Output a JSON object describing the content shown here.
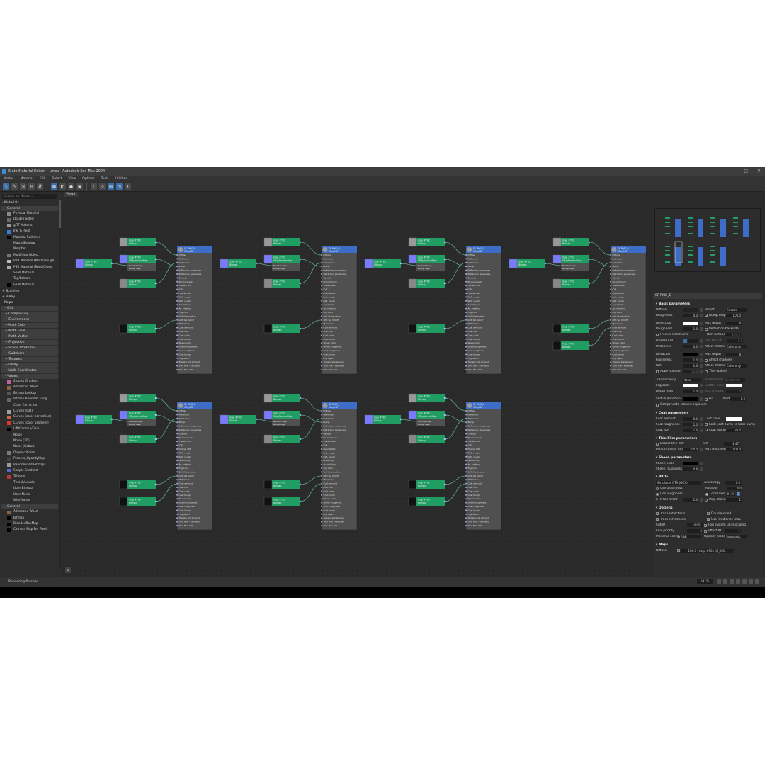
{
  "window": {
    "app_name": "Slate Material Editor",
    "title_suffix": ".max - Autodesk 3ds Max 2024",
    "controls": [
      "—",
      "□",
      "✕"
    ]
  },
  "menu": [
    "Modes",
    "Material",
    "Edit",
    "Select",
    "View",
    "Options",
    "Tools",
    "Utilities"
  ],
  "view_tab": "View1",
  "browser": {
    "search_placeholder": "Search by Name ...",
    "sections": [
      {
        "label": "- Materials",
        "kind": "sec"
      },
      {
        "label": "- General",
        "kind": "sub"
      },
      {
        "label": "Physical Material",
        "kind": "item",
        "color": "#8a8a8a"
      },
      {
        "label": "Double Sided",
        "kind": "item",
        "color": "#6a6a6a"
      },
      {
        "label": "glTF Material",
        "kind": "item",
        "color": "#9a9a9a"
      },
      {
        "label": "Ink 'n Paint",
        "kind": "item",
        "color": "#3a7bd5"
      },
      {
        "label": "Material Switcher",
        "kind": "item",
        "color": "#000000"
      },
      {
        "label": "Matte/Shadow",
        "kind": "item",
        "color": "#2d2d2d"
      },
      {
        "label": "Morpher",
        "kind": "item",
        "color": "#2d2d2d"
      },
      {
        "label": "Multi/Sub-Object",
        "kind": "item",
        "color": "#777777"
      },
      {
        "label": "PBR Material (Metal/Rough)",
        "kind": "item",
        "color": "#bbbbbb"
      },
      {
        "label": "PBR Material (Spec/Gloss)",
        "kind": "item",
        "color": "#aaaaaa"
      },
      {
        "label": "Shell Material",
        "kind": "item",
        "color": "#2d2d2d"
      },
      {
        "label": "Top/Bottom",
        "kind": "item",
        "color": "#2d2d2d"
      },
      {
        "label": "Shell Material",
        "kind": "item",
        "color": "#000000"
      },
      {
        "label": "+ Scanline",
        "kind": "sec"
      },
      {
        "label": "+ V-Ray",
        "kind": "sec"
      },
      {
        "label": "- Maps",
        "kind": "sec"
      },
      {
        "label": "- OSL",
        "kind": "sub"
      },
      {
        "label": "+ Compositing",
        "kind": "sub"
      },
      {
        "label": "+ Environment",
        "kind": "sub"
      },
      {
        "label": "+ Math Color",
        "kind": "sub"
      },
      {
        "label": "+ Math Float",
        "kind": "sub"
      },
      {
        "label": "+ Math Vector",
        "kind": "sub"
      },
      {
        "label": "+ Projection",
        "kind": "sub"
      },
      {
        "label": "+ Scene Attributes",
        "kind": "sub"
      },
      {
        "label": "+ Switchers",
        "kind": "sub"
      },
      {
        "label": "+ Textures",
        "kind": "sub"
      },
      {
        "label": "+ Utility",
        "kind": "sub"
      },
      {
        "label": "+ UVW Coordinates",
        "kind": "sub"
      },
      {
        "label": "- Values",
        "kind": "sub"
      },
      {
        "label": "4-point Gradient",
        "kind": "item",
        "color": "#c060a0"
      },
      {
        "label": "Advanced Wood",
        "kind": "item",
        "color": "#8a6040"
      },
      {
        "label": "Bitmap Lookup",
        "kind": "item",
        "color": "#555555"
      },
      {
        "label": "Bitmap Random Tiling",
        "kind": "item",
        "color": "#666666"
      },
      {
        "label": "Color Correction",
        "kind": "item",
        "color": "#2d2d2d"
      },
      {
        "label": "Curve (float)",
        "kind": "item",
        "color": "#a0a0a0"
      },
      {
        "label": "Curves (color correction)",
        "kind": "item",
        "color": "#cc6644"
      },
      {
        "label": "Curves (color gradient)",
        "kind": "item",
        "color": "#dd3333"
      },
      {
        "label": "Lift/Gamma/Gain",
        "kind": "item",
        "color": "#000000"
      },
      {
        "label": "Noise",
        "kind": "item",
        "color": "#2d2d2d"
      },
      {
        "label": "Noise (3D)",
        "kind": "item",
        "color": "#2d2d2d"
      },
      {
        "label": "Noise (Gabor)",
        "kind": "item",
        "color": "#2d2d2d"
      },
      {
        "label": "Organic Noise",
        "kind": "item",
        "color": "#7a7a7a"
      },
      {
        "label": "Process_OpacityMap",
        "kind": "item",
        "color": "#444444"
      },
      {
        "label": "Randomized Bitmaps",
        "kind": "item",
        "color": "#999999"
      },
      {
        "label": "Simple Gradient",
        "kind": "item",
        "color": "#5566cc"
      },
      {
        "label": "Tri-tone",
        "kind": "item",
        "color": "#bb3333"
      },
      {
        "label": "Thresh/Levels",
        "kind": "item",
        "color": "#2d2d2d"
      },
      {
        "label": "Uber Bitmap",
        "kind": "item",
        "color": "#2d2d2d"
      },
      {
        "label": "Uber Noise",
        "kind": "item",
        "color": "#2d2d2d"
      },
      {
        "label": "WireFrame",
        "kind": "item",
        "color": "#2d2d2d"
      },
      {
        "label": "- General",
        "kind": "sub"
      },
      {
        "label": "Advanced Wood",
        "kind": "item",
        "color": "#8a6040"
      },
      {
        "label": "Bitmap",
        "kind": "item",
        "color": "#000000"
      },
      {
        "label": "BlendedBoxMap",
        "kind": "item",
        "color": "#000000"
      },
      {
        "label": "Camera Map Per Pixel",
        "kind": "item",
        "color": "#000000"
      }
    ]
  },
  "graph": {
    "groups": [
      {
        "mat": "SF RMG_8",
        "row": 0,
        "col": 0
      },
      {
        "mat": "SF RMG_9",
        "row": 0,
        "col": 1
      },
      {
        "mat": "SF RMG_C",
        "row": 0,
        "col": 2
      },
      {
        "mat": "SF RMG_0",
        "row": 0,
        "col": 3
      },
      {
        "mat": "SF RMG_E",
        "row": 1,
        "col": 0
      },
      {
        "mat": "SF RMG_F",
        "row": 1,
        "col": 1
      },
      {
        "mat": "SF RMG_A",
        "row": 1,
        "col": 2
      }
    ],
    "map_node_title": "map #782",
    "map_node_type": "Bitmap",
    "normal_node_type": "VRayNormalMap",
    "normal_ports": [
      "Normal map",
      "Bump map"
    ],
    "mat_type": "VRayMtl",
    "mat_ports": [
      "Diffuse",
      "Reflection",
      "Refraction",
      "Bump",
      "Reflection roughness",
      "Refraction glossiness",
      "Opacity",
      "Environment",
      "Translucent",
      "IOR",
      "Fresnel IOR",
      "Refl. rough",
      "Refr. rough",
      "Anisotropy",
      "An. rotation",
      "Fog color",
      "Self illumination",
      "GTR tail falloff",
      "Metalness",
      "Coat amount",
      "Coat IOR",
      "Coat color",
      "Coat bump",
      "Sheen color",
      "Sheen roughness",
      "Coat roughness",
      "Coat bump",
      "Fog depth",
      "Translucent amount",
      "Thin Film Thickness",
      "Thin Film IOR"
    ]
  },
  "props": {
    "header": "SF RMG_E",
    "basic": {
      "title": "Basic parameters",
      "diffuse": "Diffuse",
      "roughness": "Roughness",
      "roughness_val": "0.0",
      "preset": "Preset",
      "preset_val": "Custom",
      "bump_map": "Bump map",
      "bump_val": "100.0",
      "reflection": "Reflection",
      "max_depth": "Max depth",
      "max_depth_val": "8",
      "refl_roughness": "Roughness",
      "refl_roughness_val": "1.0",
      "reflect_backside": "Reflect on backside",
      "fresnel": "Fresnel reflections",
      "dim_distance": "Dim distance",
      "dim_val": "100.0",
      "fresnel_ior": "Fresnel IOR",
      "dim_fall_off": "Dim fall off",
      "dim_fall_val": "0.0",
      "metalness": "Metalness",
      "metalness_val": "0.0",
      "affect_channels": "Affect channels",
      "affect_val": "Color only",
      "refraction": "Refraction",
      "refr_max_depth_val": "8",
      "glossiness": "Glossiness",
      "glossiness_val": "1.0",
      "affect_shadows": "Affect shadows",
      "ior": "IOR",
      "ior_val": "1.6",
      "affect_channels2_val": "Color only",
      "abbe": "Abbe number",
      "abbe_val": "50.0",
      "thin_walled": "Thin-walled",
      "translucency": "Translucency",
      "translucency_val": "None",
      "illumination": "Illumination",
      "illumination_val": "Directional",
      "fog_color": "Fog color",
      "scatter_color": "Scatter color",
      "depth": "Depth (cm)",
      "depth_val": "1.0",
      "sss_amount": "SSS amount",
      "sss_val": "1.0",
      "self_illum": "Self-illumination",
      "gi": "GI",
      "mult": "Mult",
      "mult_val": "1.0",
      "compensate": "Compensate camera exposure"
    },
    "coat": {
      "title": "Coat parameters",
      "coat_amount": "Coat amount",
      "coat_amount_val": "0.0",
      "coat_color": "Coat color",
      "coat_roughness": "Coat roughness",
      "coat_roughness_val": "1.0",
      "lock_coat": "Lock coat bump to base bump",
      "coat_ior": "Coat IOR",
      "coat_ior_val": "1.6",
      "coat_bump": "Coat bump",
      "coat_bump_val": "30.0"
    },
    "thinfilm": {
      "title": "Thin Film parameters",
      "enable": "Enable thin film",
      "ior": "IOR",
      "ior_val": "1.47",
      "min": "Min thickness (nm)",
      "min_val": "250.0",
      "max": "Max thickness (nm)",
      "max_val": "400.0"
    },
    "sheen": {
      "title": "Sheen parameters",
      "sheen_color": "Sheen color",
      "sheen_roughness": "Sheen roughness",
      "sheen_roughness_val": "0.8"
    },
    "brdf": {
      "title": "BRDF",
      "type": "Microfacet GTR (GGX)",
      "anisotropy": "Anisotropy",
      "anisotropy_val": "0.0",
      "use_gloss": "Use glossiness",
      "rotation": "Rotation",
      "rotation_val": "0.0",
      "use_rough": "Use roughness",
      "local_axis": "Local axis",
      "axes": [
        "X",
        "Y",
        "Z"
      ],
      "gtr": "GTR tail falloff",
      "gtr_val": "2.0",
      "map_channel": "Map channel",
      "map_channel_val": "1"
    },
    "options": {
      "title": "Options",
      "trace_refl": "Trace reflections",
      "double_sided": "Double-sided",
      "trace_refr": "Trace refractions",
      "irradiance": "Use irradiance map",
      "cutoff": "Cutoff",
      "cutoff_val": "0.001",
      "fog_units": "Fog system units scaling",
      "env_priority": "Env. priority",
      "env_priority_val": "0",
      "effect_id": "Effect ID",
      "effect_id_val": "0",
      "preserve": "Preserve energy",
      "preserve_val": "RGB",
      "opacity_mode": "Opacity mode",
      "opacity_mode_val": "Stochastic"
    },
    "maps": {
      "title": "Maps",
      "diffuse": "Diffuse",
      "diffuse_val": "100.0",
      "diffuse_map": "map #901 (0_001..."
    }
  },
  "status": {
    "text": "Rendering finished",
    "zoom": "191%"
  },
  "colors": {
    "bitmap_node": "#1f9d63",
    "material_header": "#3d6dc6",
    "material_body": "#505050",
    "swatch_blue": "#7a7aff",
    "wire": "#5fa89a"
  }
}
